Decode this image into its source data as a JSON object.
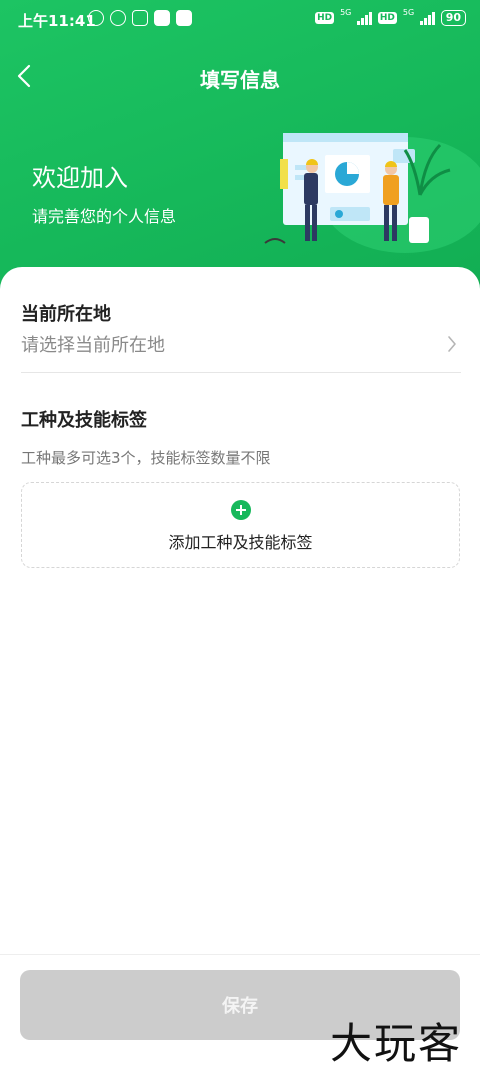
{
  "status_bar": {
    "time": "上午11:41",
    "battery": "90",
    "network_1": "5G",
    "network_2": "5G",
    "hd_1": "HD",
    "hd_2": "HD"
  },
  "header": {
    "title": "填写信息",
    "back_icon": "chevron-left-icon"
  },
  "welcome": {
    "title": "欢迎加入",
    "subtitle": "请完善您的个人信息"
  },
  "location": {
    "label": "当前所在地",
    "placeholder": "请选择当前所在地"
  },
  "skills": {
    "label": "工种及技能标签",
    "hint": "工种最多可选3个，技能标签数量不限",
    "add_label": "添加工种及技能标签"
  },
  "footer": {
    "save_label": "保存"
  },
  "watermark": "大玩客",
  "colors": {
    "primary_green": "#17b85b",
    "disabled_button": "#cccccc"
  }
}
